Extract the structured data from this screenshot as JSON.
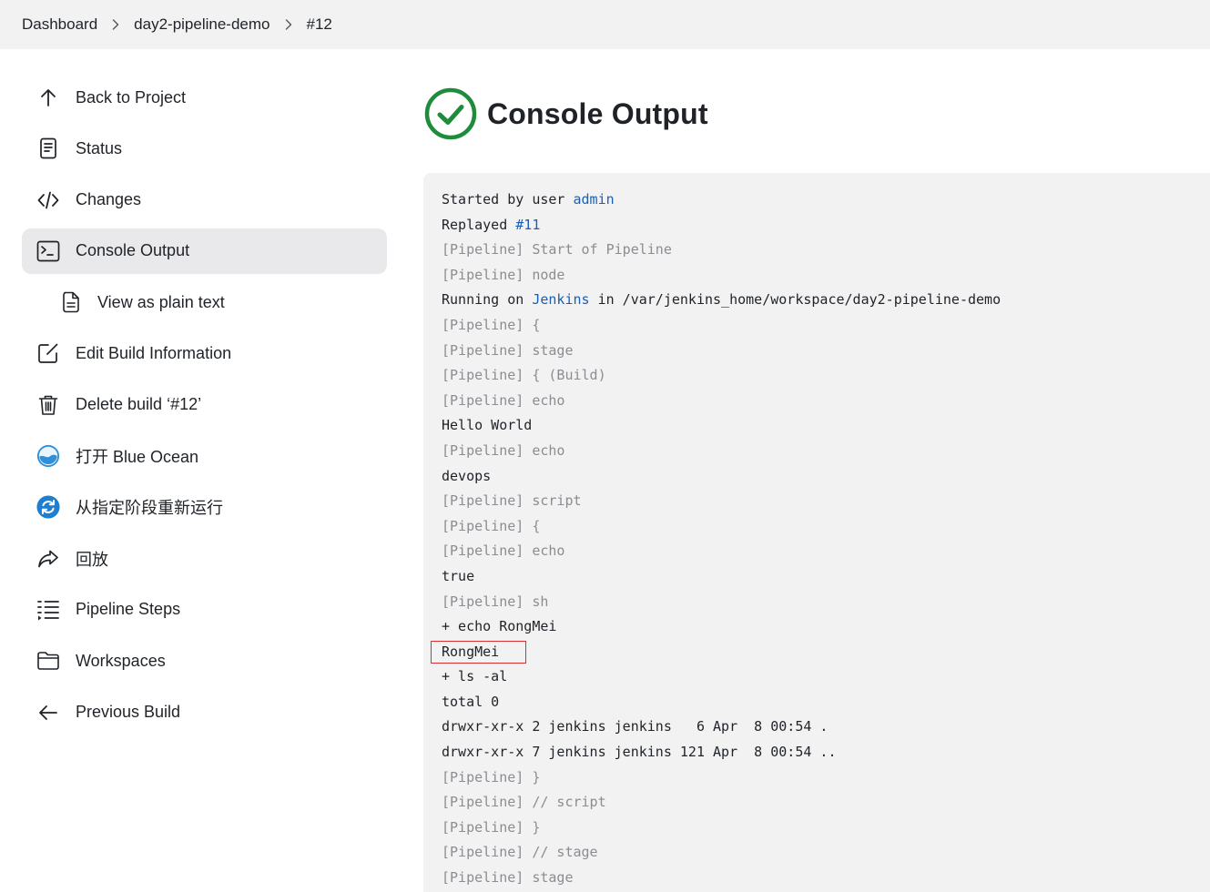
{
  "breadcrumb": {
    "items": [
      "Dashboard",
      "day2-pipeline-demo",
      "#12"
    ]
  },
  "sidebar": {
    "items": [
      {
        "label": "Back to Project",
        "icon": "arrow-up-icon"
      },
      {
        "label": "Status",
        "icon": "document-icon"
      },
      {
        "label": "Changes",
        "icon": "code-icon"
      },
      {
        "label": "Console Output",
        "icon": "terminal-icon",
        "active": true
      },
      {
        "label": "View as plain text",
        "icon": "file-text-icon"
      },
      {
        "label": "Edit Build Information",
        "icon": "edit-icon"
      },
      {
        "label": "Delete build ‘#12’",
        "icon": "trash-icon"
      },
      {
        "label": "打开 Blue Ocean",
        "icon": "blue-ocean-icon"
      },
      {
        "label": "从指定阶段重新运行",
        "icon": "restart-stage-icon"
      },
      {
        "label": "回放",
        "icon": "replay-icon"
      },
      {
        "label": "Pipeline Steps",
        "icon": "pipeline-steps-icon"
      },
      {
        "label": "Workspaces",
        "icon": "folder-icon"
      },
      {
        "label": "Previous Build",
        "icon": "arrow-left-icon"
      }
    ]
  },
  "page": {
    "title": "Console Output",
    "status": "success",
    "status_color": "#1e8c3a"
  },
  "console": {
    "lines": [
      {
        "parts": [
          {
            "t": "Started by user "
          },
          {
            "t": "admin",
            "link": true
          }
        ]
      },
      {
        "parts": [
          {
            "t": "Replayed "
          },
          {
            "t": "#11",
            "link": true
          }
        ]
      },
      {
        "parts": [
          {
            "t": "[Pipeline] Start of Pipeline"
          }
        ],
        "dim": true
      },
      {
        "parts": [
          {
            "t": "[Pipeline] node"
          }
        ],
        "dim": true
      },
      {
        "parts": [
          {
            "t": "Running on "
          },
          {
            "t": "Jenkins",
            "link": true
          },
          {
            "t": " in /var/jenkins_home/workspace/day2-pipeline-demo"
          }
        ]
      },
      {
        "parts": [
          {
            "t": "[Pipeline] {"
          }
        ],
        "dim": true
      },
      {
        "parts": [
          {
            "t": "[Pipeline] stage"
          }
        ],
        "dim": true
      },
      {
        "parts": [
          {
            "t": "[Pipeline] { (Build)"
          }
        ],
        "dim": true
      },
      {
        "parts": [
          {
            "t": "[Pipeline] echo"
          }
        ],
        "dim": true
      },
      {
        "parts": [
          {
            "t": "Hello World"
          }
        ]
      },
      {
        "parts": [
          {
            "t": "[Pipeline] echo"
          }
        ],
        "dim": true
      },
      {
        "parts": [
          {
            "t": "devops"
          }
        ]
      },
      {
        "parts": [
          {
            "t": "[Pipeline] script"
          }
        ],
        "dim": true
      },
      {
        "parts": [
          {
            "t": "[Pipeline] {"
          }
        ],
        "dim": true
      },
      {
        "parts": [
          {
            "t": "[Pipeline] echo"
          }
        ],
        "dim": true
      },
      {
        "parts": [
          {
            "t": "true"
          }
        ]
      },
      {
        "parts": [
          {
            "t": "[Pipeline] sh"
          }
        ],
        "dim": true
      },
      {
        "parts": [
          {
            "t": "+ echo RongMei"
          }
        ]
      },
      {
        "parts": [
          {
            "t": "RongMei"
          }
        ],
        "highlight": true
      },
      {
        "parts": [
          {
            "t": "+ ls -al"
          }
        ]
      },
      {
        "parts": [
          {
            "t": "total 0"
          }
        ]
      },
      {
        "parts": [
          {
            "t": "drwxr-xr-x 2 jenkins jenkins   6 Apr  8 00:54 ."
          }
        ]
      },
      {
        "parts": [
          {
            "t": "drwxr-xr-x 7 jenkins jenkins 121 Apr  8 00:54 .."
          }
        ]
      },
      {
        "parts": [
          {
            "t": "[Pipeline] }"
          }
        ],
        "dim": true
      },
      {
        "parts": [
          {
            "t": "[Pipeline] // script"
          }
        ],
        "dim": true
      },
      {
        "parts": [
          {
            "t": "[Pipeline] }"
          }
        ],
        "dim": true
      },
      {
        "parts": [
          {
            "t": "[Pipeline] // stage"
          }
        ],
        "dim": true
      },
      {
        "parts": [
          {
            "t": "[Pipeline] stage"
          }
        ],
        "dim": true
      }
    ]
  },
  "colors": {
    "link": "#1a5fb4",
    "dim_text": "#8c8c92",
    "highlight_border": "#d93131"
  }
}
